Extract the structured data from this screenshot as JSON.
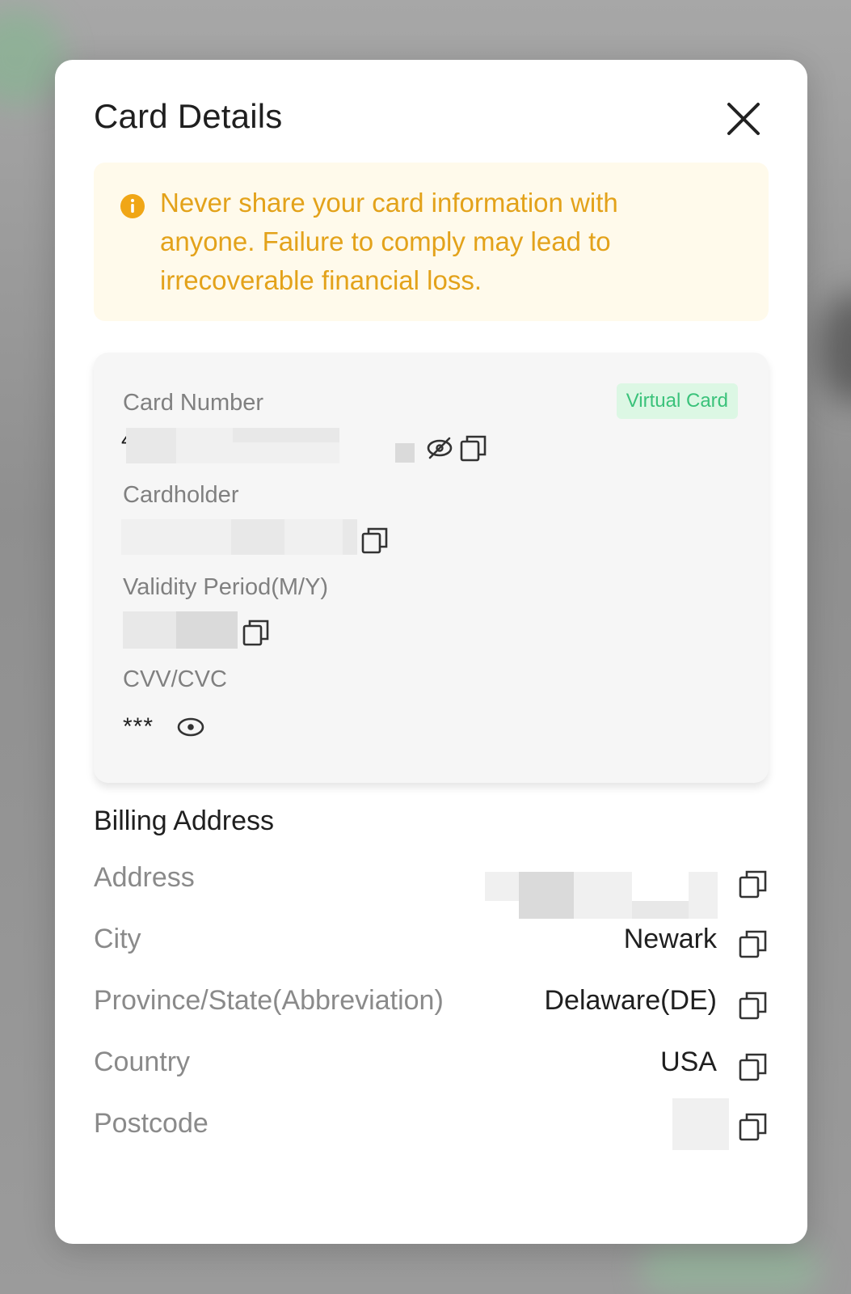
{
  "modal": {
    "title": "Card Details",
    "close_icon": "close-icon"
  },
  "warning": {
    "icon": "info-circle-icon",
    "text": "Never share your card information with anyone. Failure to comply may lead to irrecoverable financial loss.",
    "color": "#e3a21a",
    "background": "#fffaeb"
  },
  "card": {
    "badge": "Virtual Card",
    "badge_color": "#3ac27a",
    "card_number_label": "Card Number",
    "card_number_prefix": "4",
    "cardholder_label": "Cardholder",
    "validity_label": "Validity Period(M/Y)",
    "cvv_label": "CVV/CVC",
    "cvv_value": "***"
  },
  "billing": {
    "title": "Billing Address",
    "rows": [
      {
        "label": "Address",
        "value": ""
      },
      {
        "label": "City",
        "value": "Newark"
      },
      {
        "label": "Province/State(Abbreviation)",
        "value": "Delaware(DE)"
      },
      {
        "label": "Country",
        "value": "USA"
      },
      {
        "label": "Postcode",
        "value": ""
      }
    ]
  }
}
